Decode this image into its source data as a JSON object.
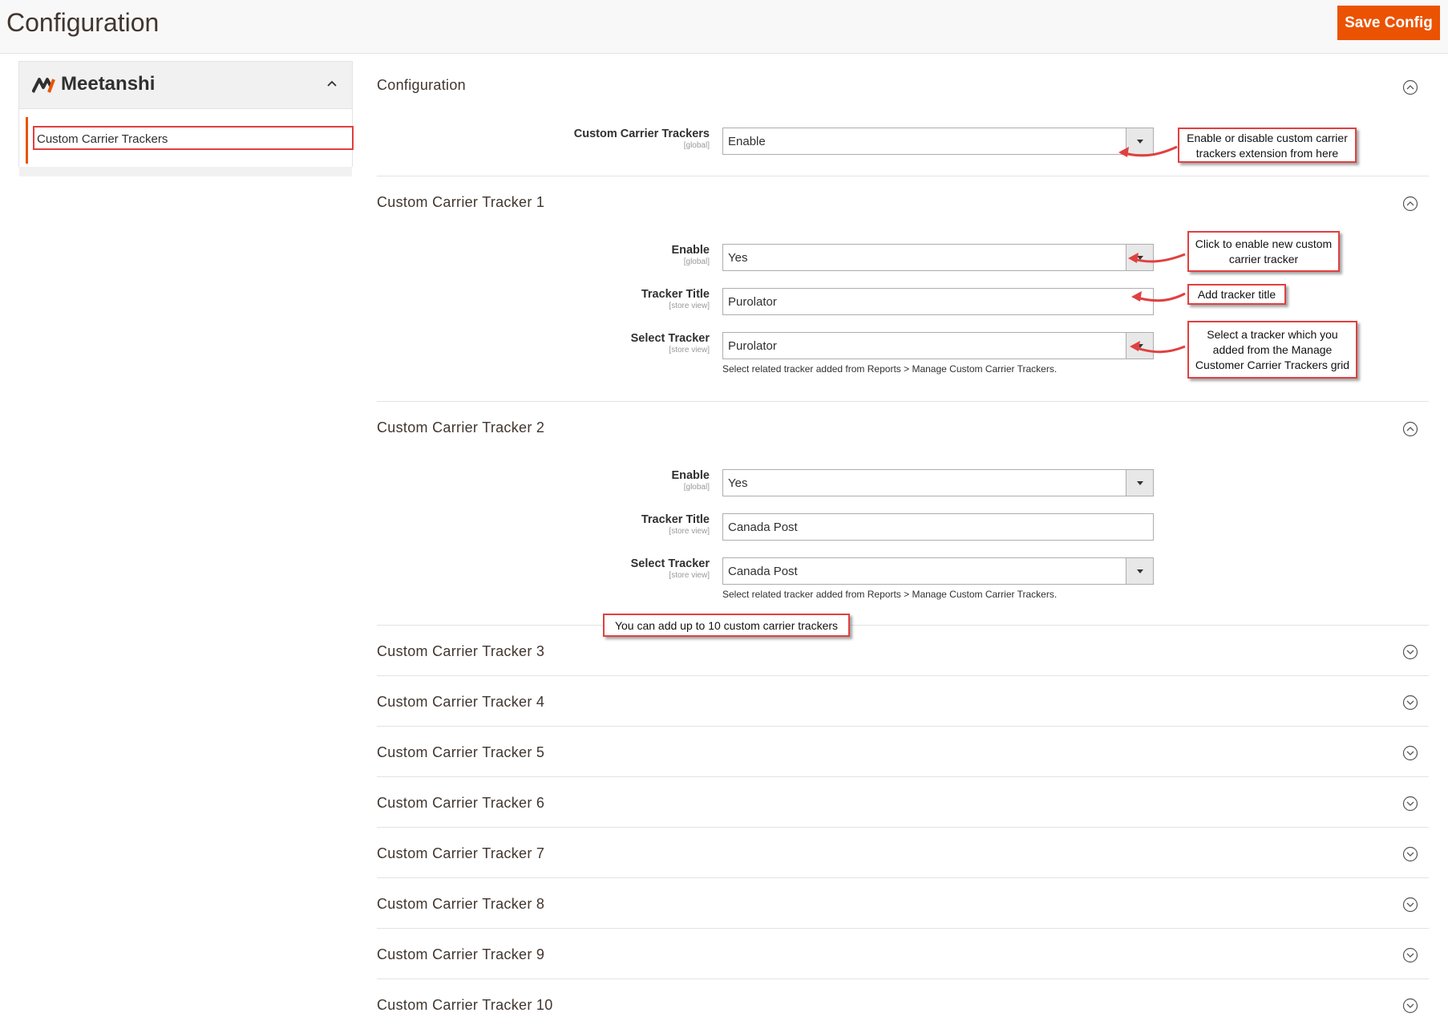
{
  "header": {
    "title": "Configuration",
    "save_label": "Save Config"
  },
  "sidebar": {
    "brand": "Meetanshi",
    "items": [
      {
        "label": "Custom Carrier Trackers"
      }
    ]
  },
  "sections": [
    {
      "title": "Configuration",
      "expanded": true,
      "fields": [
        {
          "label": "Custom Carrier Trackers",
          "scope": "[global]",
          "type": "select",
          "value": "Enable"
        }
      ]
    },
    {
      "title": "Custom Carrier Tracker 1",
      "expanded": true,
      "fields": [
        {
          "label": "Enable",
          "scope": "[global]",
          "type": "select",
          "value": "Yes"
        },
        {
          "label": "Tracker Title",
          "scope": "[store view]",
          "type": "text",
          "value": "Purolator"
        },
        {
          "label": "Select Tracker",
          "scope": "[store view]",
          "type": "select",
          "value": "Purolator",
          "hint": "Select related tracker added from Reports > Manage Custom Carrier Trackers."
        }
      ]
    },
    {
      "title": "Custom Carrier Tracker 2",
      "expanded": true,
      "fields": [
        {
          "label": "Enable",
          "scope": "[global]",
          "type": "select",
          "value": "Yes"
        },
        {
          "label": "Tracker Title",
          "scope": "[store view]",
          "type": "text",
          "value": "Canada Post"
        },
        {
          "label": "Select Tracker",
          "scope": "[store view]",
          "type": "select",
          "value": "Canada Post",
          "hint": "Select related tracker added from Reports > Manage Custom Carrier Trackers."
        }
      ]
    },
    {
      "title": "Custom Carrier Tracker 3",
      "expanded": false
    },
    {
      "title": "Custom Carrier Tracker 4",
      "expanded": false
    },
    {
      "title": "Custom Carrier Tracker 5",
      "expanded": false
    },
    {
      "title": "Custom Carrier Tracker 6",
      "expanded": false
    },
    {
      "title": "Custom Carrier Tracker 7",
      "expanded": false
    },
    {
      "title": "Custom Carrier Tracker 8",
      "expanded": false
    },
    {
      "title": "Custom Carrier Tracker 9",
      "expanded": false
    },
    {
      "title": "Custom Carrier Tracker 10",
      "expanded": false
    }
  ],
  "callouts": {
    "enable_ext": [
      "Enable or disable custom carrier",
      "trackers extension from here"
    ],
    "enable_tracker": [
      "Click to enable new custom",
      "carrier tracker"
    ],
    "tracker_title": [
      "Add tracker title"
    ],
    "select_tracker": [
      "Select a tracker which you",
      "added from the Manage",
      "Customer Carrier Trackers grid"
    ],
    "up_to_10": [
      "You can add up to 10 custom carrier trackers"
    ]
  },
  "colors": {
    "accent": "#eb5202",
    "callout_border": "#e04040",
    "text": "#303030"
  },
  "icons": {
    "collapse": "circle-chevron-up-icon",
    "expand": "circle-chevron-down-icon",
    "select_arrow": "triangle-down-icon"
  }
}
